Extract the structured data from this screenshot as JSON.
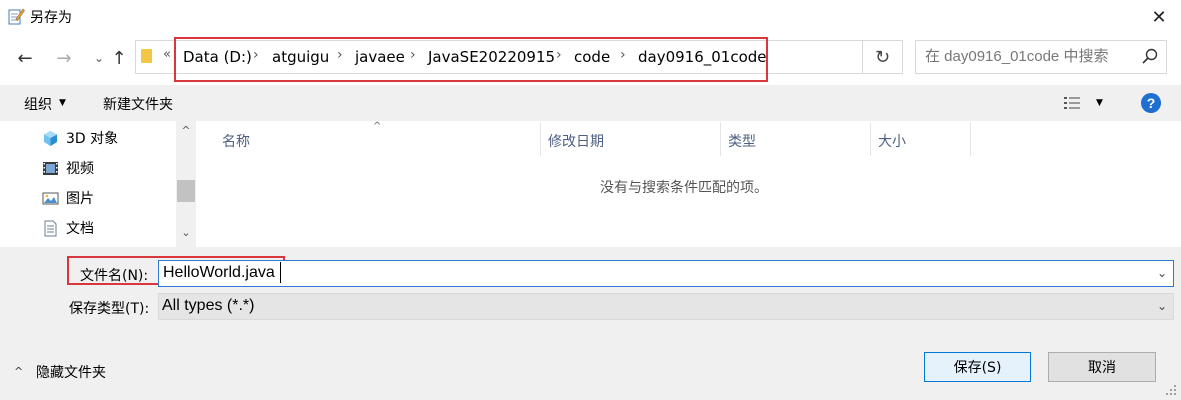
{
  "window": {
    "title": "另存为",
    "close_glyph": "✕"
  },
  "nav": {
    "back_glyph": "←",
    "forward_glyph": "→",
    "recent_glyph": "⌄",
    "up_glyph": "↑",
    "overflow_glyph": "«",
    "breadcrumbs": [
      "Data (D:)",
      "atguigu",
      "javaee",
      "JavaSE20220915",
      "code",
      "day0916_01code"
    ],
    "separator": "›",
    "refresh_glyph": "↻"
  },
  "search": {
    "placeholder": "在 day0916_01code 中搜索"
  },
  "toolbar": {
    "organize_label": "组织",
    "dropdown_glyph": "▼",
    "new_folder_label": "新建文件夹",
    "help_glyph": "?"
  },
  "sidebar": {
    "items": [
      {
        "label": "3D 对象",
        "icon": "3d-objects-icon"
      },
      {
        "label": "视频",
        "icon": "video-icon"
      },
      {
        "label": "图片",
        "icon": "pictures-icon"
      },
      {
        "label": "文档",
        "icon": "documents-icon"
      }
    ],
    "scroll_up_glyph": "^",
    "scroll_down_glyph": "⌄"
  },
  "file_list": {
    "columns": [
      "名称",
      "修改日期",
      "类型",
      "大小"
    ],
    "sort_glyph": "^",
    "empty_message": "没有与搜索条件匹配的项。"
  },
  "form": {
    "filename_label": "文件名(N):",
    "filename_value": "HelloWorld.java",
    "filetype_label": "保存类型(T):",
    "filetype_value": "All types (*.*)",
    "dropdown_glyph": "⌄"
  },
  "footer": {
    "hide_folders_glyph": "^",
    "hide_folders_label": "隐藏文件夹",
    "save_label": "保存(S)",
    "cancel_label": "取消"
  },
  "colors": {
    "highlight_red": "#d9363e",
    "accent_blue": "#0078d7",
    "toolbar_bg": "#f0f0f0"
  }
}
